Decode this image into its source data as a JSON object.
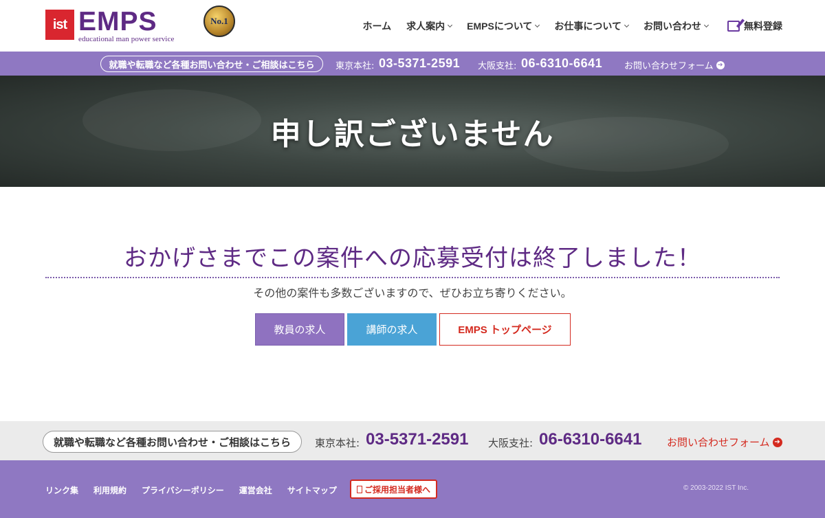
{
  "brand": {
    "ist": "ist",
    "name": "EMPS",
    "tagline": "educational man power service",
    "badge": "No.1"
  },
  "nav": {
    "items": [
      {
        "label": "ホーム",
        "dropdown": false
      },
      {
        "label": "求人案内",
        "dropdown": true
      },
      {
        "label": "EMPSについて",
        "dropdown": true
      },
      {
        "label": "お仕事について",
        "dropdown": true
      },
      {
        "label": "お問い合わせ",
        "dropdown": true
      }
    ],
    "register": "無料登録"
  },
  "topbar": {
    "pill": "就職や転職など各種お問い合わせ・ご相談はこちら",
    "tokyo_label": "東京本社:",
    "tokyo_phone": "03-5371-2591",
    "osaka_label": "大阪支社:",
    "osaka_phone": "06-6310-6641",
    "form_link": "お問い合わせフォーム"
  },
  "hero": {
    "title": "申し訳ございません"
  },
  "main": {
    "heading": "おかげさまでこの案件への応募受付は終了しました！",
    "subtext": "その他の案件も多数ございますので、ぜひお立ち寄りください。",
    "buttons": {
      "teacher": "教員の求人",
      "lecturer": "講師の求人",
      "top": "EMPS トップページ"
    }
  },
  "contactbar": {
    "pill": "就職や転職など各種お問い合わせ・ご相談はこちら",
    "tokyo_label": "東京本社:",
    "tokyo_phone": "03-5371-2591",
    "osaka_label": "大阪支社:",
    "osaka_phone": "06-6310-6641",
    "form_link": "お問い合わせフォーム"
  },
  "footer": {
    "links": [
      "リンク集",
      "利用規約",
      "プライバシーポリシー",
      "運営会社",
      "サイトマップ"
    ],
    "recruiter_button": "ご採用担当者様へ",
    "copyright": "© 2003-2022 IST Inc."
  },
  "colors": {
    "brand_purple": "#5e2a84",
    "bar_purple": "#8f78c2",
    "accent_red": "#d42a1f",
    "button_blue": "#4aa3d6"
  }
}
